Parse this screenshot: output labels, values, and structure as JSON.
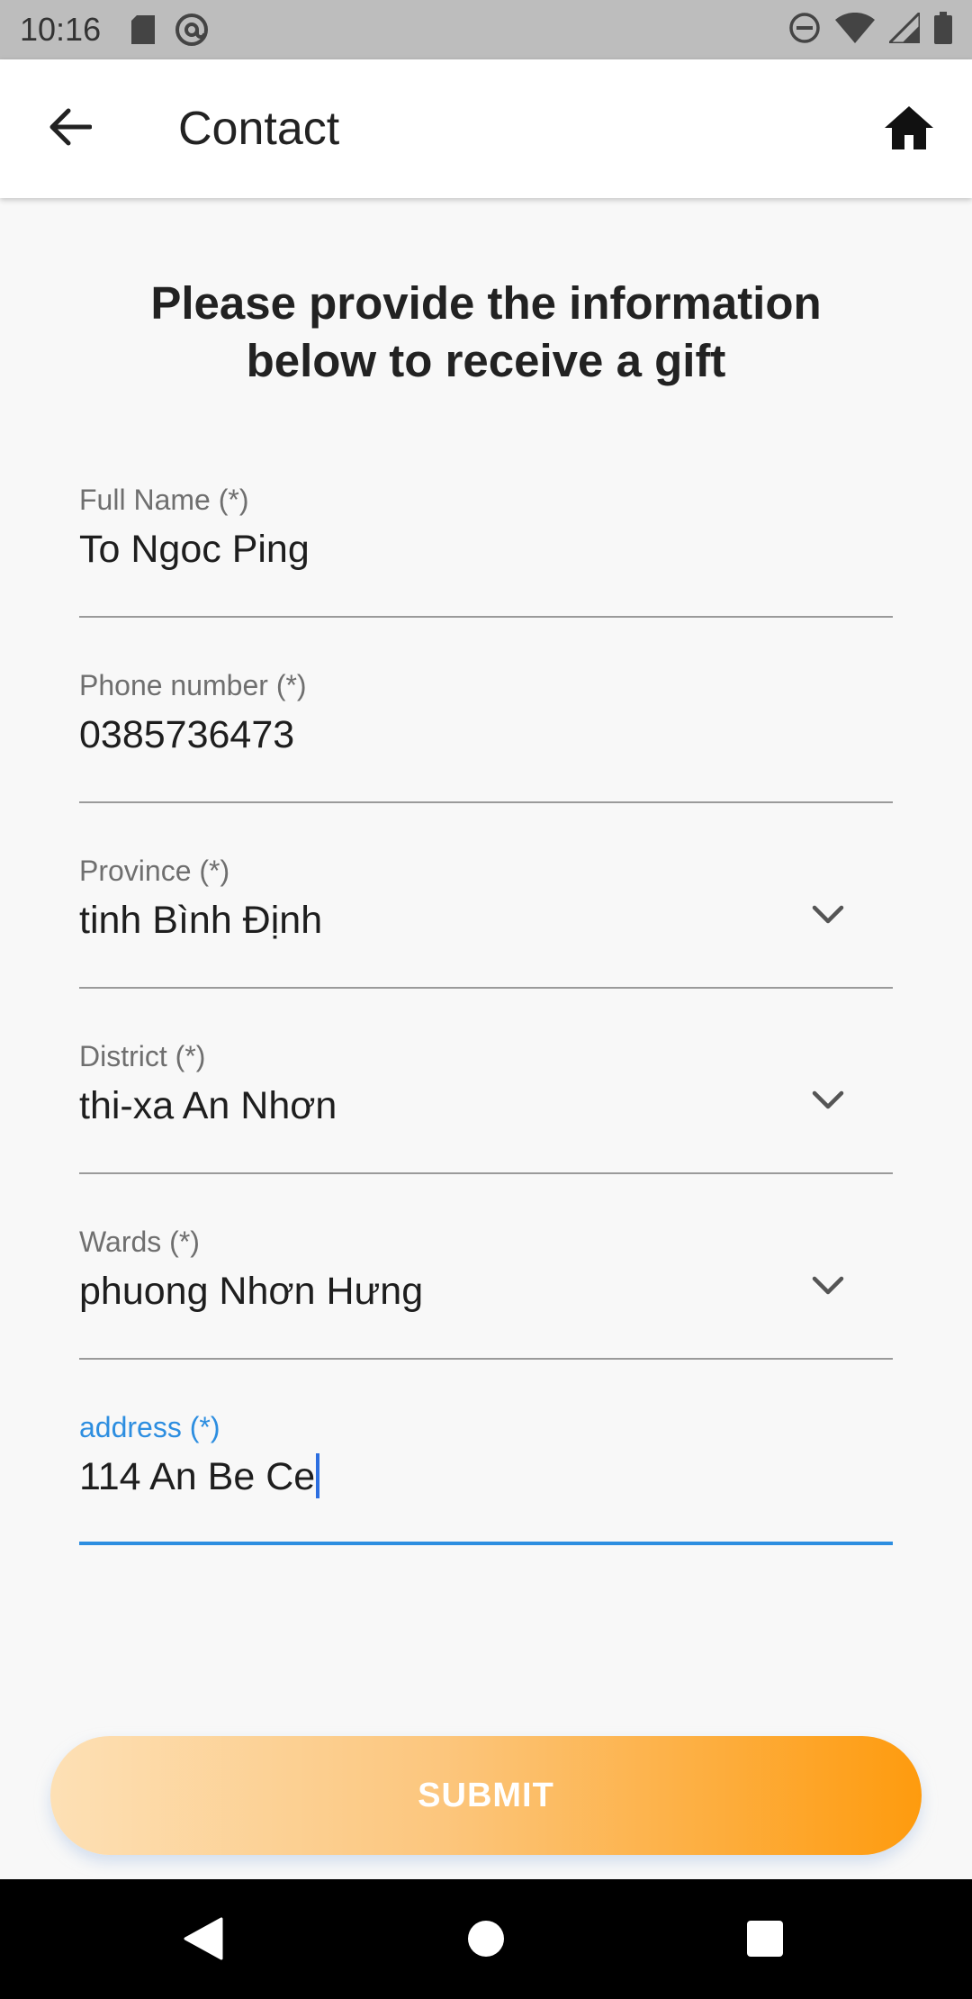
{
  "status_bar": {
    "time": "10:16",
    "icons": [
      "sd-card-icon",
      "at-sign-icon",
      "do-not-disturb-icon",
      "wifi-icon",
      "signal-icon",
      "battery-icon"
    ]
  },
  "app_bar": {
    "title": "Contact",
    "back_icon": "arrow-left-icon",
    "home_icon": "home-icon"
  },
  "form": {
    "heading_line1": "Please provide the information",
    "heading_line2": "below to receive a gift",
    "fields": [
      {
        "label": "Full Name (*)",
        "value": "To Ngoc Ping",
        "type": "text"
      },
      {
        "label": "Phone number (*)",
        "value": "0385736473",
        "type": "text"
      },
      {
        "label": "Province (*)",
        "value": "tinh Bình Định",
        "type": "dropdown"
      },
      {
        "label": "District (*)",
        "value": "thi-xa An Nhơn",
        "type": "dropdown"
      },
      {
        "label": "Wards (*)",
        "value": "phuong Nhơn Hưng",
        "type": "dropdown"
      },
      {
        "label": "address (*)",
        "value": "114 An Be Ce",
        "type": "text",
        "focused": true
      }
    ],
    "submit_label": "SUBMIT"
  },
  "colors": {
    "accent": "#2d8ee0",
    "submit_gradient_start": "#fde0b5",
    "submit_gradient_end": "#fe9b0e"
  },
  "nav_bar": {
    "back_icon": "triangle-back-icon",
    "home_icon": "circle-home-icon",
    "recents_icon": "square-recents-icon"
  }
}
